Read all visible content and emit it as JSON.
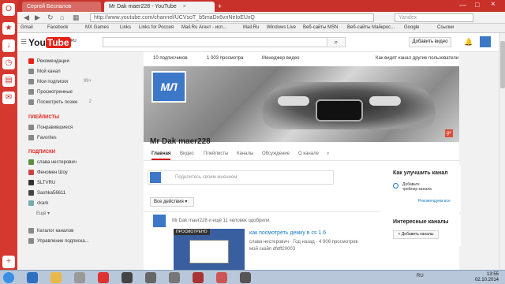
{
  "browser": {
    "tabs": [
      {
        "label": "Сергей Беспалов",
        "active": false
      },
      {
        "label": "Mr Dak maer228 - YouTube",
        "active": true
      }
    ],
    "url": "http://www.youtube.com/channel/UCVsoT_b5maDx6vnNeIoEUxQ",
    "search_placeholder": "Yandex",
    "bookmarks": [
      "Gmail",
      "Facebook",
      "MX Games",
      "Links",
      "Links for Россия",
      "Mail.Ru Агент - исп...",
      "Mail.Ru",
      "Windows Live",
      "Веб-сайты MSN",
      "Веб-сайты Майкрос...",
      "Google",
      "Ссылки"
    ]
  },
  "youtube": {
    "logo_you": "You",
    "logo_tube": "Tube",
    "logo_region": "RU",
    "upload_label": "Добавить видео",
    "guide": {
      "items": [
        {
          "label": "Рекомендации",
          "count": ""
        },
        {
          "label": "Мой канал",
          "count": ""
        },
        {
          "label": "Мои подписки",
          "count": "99+"
        },
        {
          "label": "Просмотренные",
          "count": ""
        },
        {
          "label": "Посмотреть позже",
          "count": "2"
        }
      ],
      "playlists_heading": "ПЛЕЙЛИСТЫ",
      "playlists": [
        "Понравившиеся",
        "Favorites"
      ],
      "subs_heading": "ПОДПИСКИ",
      "subs": [
        "слава нестерович",
        "Феномен Шоу",
        "SLTVRU",
        "Sashka56611",
        "ckark"
      ],
      "more": "Ещё",
      "bottom": [
        "Каталог каналов",
        "Управление подписка..."
      ]
    },
    "channel": {
      "stats": {
        "subscribers": "10 подписчиков",
        "views": "1 003 просмотра",
        "manager": "Менеджер видео",
        "view_as": "Как видят канал другие пользователи"
      },
      "avatar_text": "МЛ",
      "name": "Mr Dak maer228",
      "tabs": [
        "Главная",
        "Видео",
        "Плейлисты",
        "Каналы",
        "Обсуждение",
        "О канале"
      ],
      "share_placeholder": "Поделитесь своим мнением",
      "actions_label": "Все действия",
      "feed": {
        "line": "Mr Dak maer228 и ещё 11 человек одобрили",
        "thumb_label": "ПРОСМОТРЕНО",
        "video_title": "как посмотреть демку в cs 1.6",
        "video_meta": "слава нестерович · Год назад · 4 906 просмотров",
        "video_meta2": "мой скайп dfdff20003"
      }
    },
    "right": {
      "improve_title": "Как улучшить канал",
      "improve_item": "Добавьте трейлер канала",
      "improve_link": "Рекомендуем все",
      "interesting_title": "Интересные каналы",
      "add_channels": "+ Добавить каналы"
    }
  },
  "taskbar": {
    "lang": "RU",
    "time": "13:55",
    "date": "02.10.2014"
  }
}
